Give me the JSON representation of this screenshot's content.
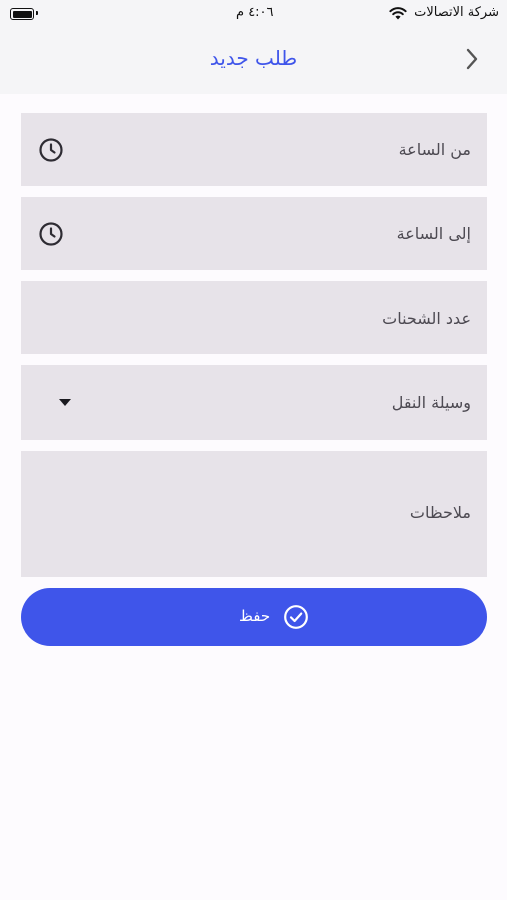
{
  "status_bar": {
    "carrier": "شركة الاتصالات",
    "time": "٤:٠٦ م",
    "wifi_icon": "wifi-icon",
    "battery_icon": "battery-icon",
    "battery_level": 1.0
  },
  "nav": {
    "title": "طلب جديد",
    "back_icon": "chevron-right-icon"
  },
  "form": {
    "from_time_label": "من الساعة",
    "to_time_label": "إلى الساعة",
    "shipments_label": "عدد الشحنات",
    "transport_label": "وسيلة النقل",
    "notes_label": "ملاحظات",
    "time_icon": "clock-icon",
    "dropdown_icon": "caret-down-icon"
  },
  "actions": {
    "save_label": "حفظ",
    "save_icon": "check-circle-icon"
  },
  "colors": {
    "accent": "#3f55ea",
    "field_bg": "#e7e3e9",
    "page_bg": "#fdfbfe",
    "bar_bg": "#f5f5f7"
  }
}
